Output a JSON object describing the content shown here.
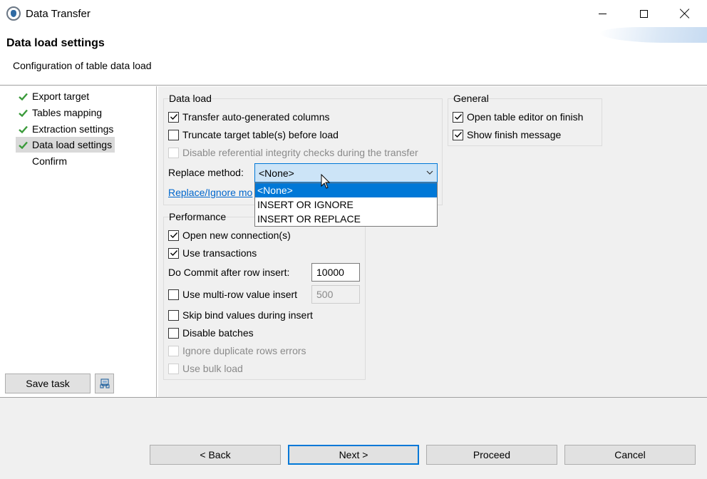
{
  "window": {
    "title": "Data Transfer"
  },
  "header": {
    "title": "Data load settings",
    "subtitle": "Configuration of table data load"
  },
  "nav": {
    "items": [
      {
        "label": "Export target",
        "done": true
      },
      {
        "label": "Tables mapping",
        "done": true
      },
      {
        "label": "Extraction settings",
        "done": true
      },
      {
        "label": "Data load settings",
        "done": true,
        "selected": true
      },
      {
        "label": "Confirm",
        "done": false
      }
    ],
    "save_task_label": "Save task"
  },
  "data_load": {
    "title": "Data load",
    "transfer_auto_generated": {
      "label": "Transfer auto-generated columns",
      "checked": true
    },
    "truncate_target": {
      "label": "Truncate target table(s) before load",
      "checked": false
    },
    "disable_ref_integrity": {
      "label": "Disable referential integrity checks during the transfer",
      "checked": false,
      "enabled": false
    },
    "replace_method": {
      "label": "Replace method:",
      "selected": "<None>",
      "options": [
        "<None>",
        "INSERT OR IGNORE",
        "INSERT OR REPLACE"
      ]
    },
    "link_label": "Replace/Ignore mo"
  },
  "general": {
    "title": "General",
    "open_table_editor": {
      "label": "Open table editor on finish",
      "checked": true
    },
    "show_finish_message": {
      "label": "Show finish message",
      "checked": true
    }
  },
  "performance": {
    "title": "Performance",
    "open_new_connection": {
      "label": "Open new connection(s)",
      "checked": true
    },
    "use_transactions": {
      "label": "Use transactions",
      "checked": true
    },
    "commit_after": {
      "label": "Do Commit after row insert:",
      "value": "10000"
    },
    "multi_row_insert": {
      "label": "Use multi-row value insert",
      "checked": false,
      "value": "500"
    },
    "skip_bind": {
      "label": "Skip bind values during insert",
      "checked": false
    },
    "disable_batches": {
      "label": "Disable batches",
      "checked": false
    },
    "ignore_duplicates": {
      "label": "Ignore duplicate rows errors",
      "checked": false,
      "enabled": false
    },
    "use_bulk_load": {
      "label": "Use bulk load",
      "checked": false,
      "enabled": false
    }
  },
  "footer": {
    "back": "< Back",
    "next": "Next >",
    "proceed": "Proceed",
    "cancel": "Cancel"
  },
  "colors": {
    "accent": "#0078d7",
    "check_green": "#3a9a3a",
    "link": "#0066cc"
  }
}
